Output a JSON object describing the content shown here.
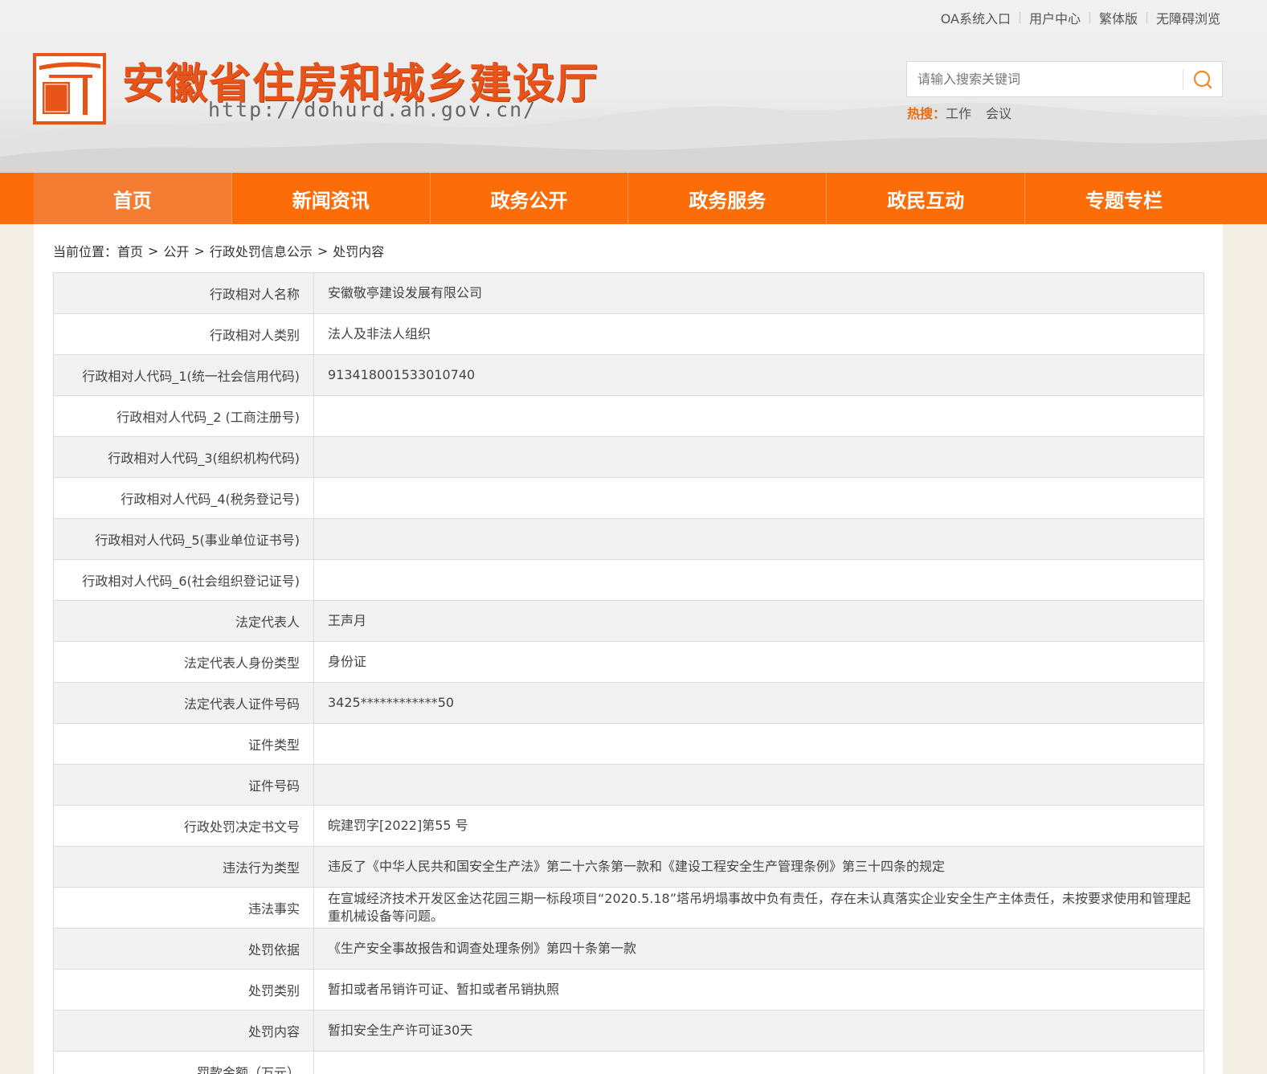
{
  "header": {
    "top_links": [
      "OA系统入口",
      "用户中心",
      "繁体版",
      "无障碍浏览"
    ],
    "site_title": "安徽省住房和城乡建设厅",
    "site_url": "http://dohurd.ah.gov.cn/",
    "logo_seal_text": "建设安徽",
    "search": {
      "placeholder": "请输入搜索关键词",
      "icon": "search-icon"
    },
    "hot_search": {
      "label": "热搜：",
      "items": [
        "工作",
        "会议"
      ]
    }
  },
  "nav": {
    "items": [
      "首页",
      "新闻资讯",
      "政务公开",
      "政务服务",
      "政民互动",
      "专题专栏"
    ],
    "active": "首页"
  },
  "breadcrumb": {
    "prefix": "当前位置：",
    "items": [
      "首页",
      "公开",
      "行政处罚信息公示",
      "处罚内容"
    ],
    "separator": ">"
  },
  "record": {
    "rows": [
      {
        "label": "行政相对人名称",
        "value": "安徽敬亭建设发展有限公司"
      },
      {
        "label": "行政相对人类别",
        "value": "法人及非法人组织"
      },
      {
        "label": "行政相对人代码_1(统一社会信用代码)",
        "value": "913418001533010740"
      },
      {
        "label": "行政相对人代码_2 (工商注册号)",
        "value": ""
      },
      {
        "label": "行政相对人代码_3(组织机构代码)",
        "value": ""
      },
      {
        "label": "行政相对人代码_4(税务登记号)",
        "value": ""
      },
      {
        "label": "行政相对人代码_5(事业单位证书号)",
        "value": ""
      },
      {
        "label": "行政相对人代码_6(社会组织登记证号)",
        "value": ""
      },
      {
        "label": "法定代表人",
        "value": "王声月"
      },
      {
        "label": "法定代表人身份类型",
        "value": "身份证"
      },
      {
        "label": "法定代表人证件号码",
        "value": "3425************50"
      },
      {
        "label": "证件类型",
        "value": ""
      },
      {
        "label": "证件号码",
        "value": ""
      },
      {
        "label": "行政处罚决定书文号",
        "value": "皖建罚字[2022]第55 号"
      },
      {
        "label": "违法行为类型",
        "value": "违反了《中华人民共和国安全生产法》第二十六条第一款和《建设工程安全生产管理条例》第三十四条的规定"
      },
      {
        "label": "违法事实",
        "value": "在宣城经济技术开发区金达花园三期一标段项目“2020.5.18”塔吊坍塌事故中负有责任，存在未认真落实企业安全生产主体责任，未按要求使用和管理起重机械设备等问题。"
      },
      {
        "label": "处罚依据",
        "value": "《生产安全事故报告和调查处理条例》第四十条第一款"
      },
      {
        "label": "处罚类别",
        "value": "暂扣或者吊销许可证、暂扣或者吊销执照"
      },
      {
        "label": "处罚内容",
        "value": "暂扣安全生产许可证30天"
      },
      {
        "label": "罚款金额（万元）",
        "value": ""
      }
    ]
  },
  "colors": {
    "brand_orange": "#fc6d0a",
    "nav_active": "#f57d33",
    "title_red": "#e8531a",
    "hot_label": "#ea6a10"
  }
}
